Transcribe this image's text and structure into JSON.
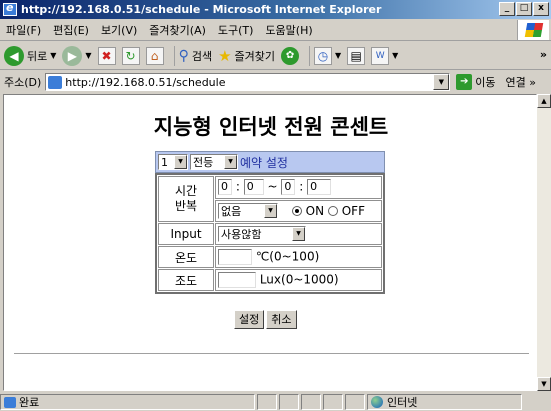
{
  "window": {
    "title": "http://192.168.0.51/schedule - Microsoft Internet Explorer",
    "btn_min": "_",
    "btn_max": "□",
    "btn_close": "x"
  },
  "menu": [
    "파일(F)",
    "편집(E)",
    "보기(V)",
    "즐겨찾기(A)",
    "도구(T)",
    "도움말(H)"
  ],
  "toolbar": {
    "back_label": "뒤로",
    "search_label": "검색",
    "favorites_label": "즐겨찾기",
    "more": "»"
  },
  "address": {
    "label": "주소(D)",
    "url": "http://192.168.0.51/schedule",
    "go_label": "이동",
    "links_label": "연결 »"
  },
  "page": {
    "title": "지능형 인터넷 전원 콘센트",
    "header": {
      "slot_value": "1",
      "device_value": "전등",
      "label": "예약 설정"
    },
    "rows": {
      "time_label": "시간",
      "time_start_h": "0",
      "time_start_m": "0",
      "time_sep": "~",
      "time_end_h": "0",
      "time_end_m": "0",
      "repeat_label": "반복",
      "repeat_value": "없음",
      "on_label": "ON",
      "off_label": "OFF",
      "input_label": "Input",
      "input_value": "사용않함",
      "temp_label": "온도",
      "temp_value": "",
      "temp_unit": "℃(0~100)",
      "lux_label": "조도",
      "lux_value": "",
      "lux_unit": "Lux(0~1000)"
    },
    "buttons": {
      "set": "설정",
      "cancel": "취소"
    }
  },
  "status": {
    "left": "완료",
    "zone": "인터넷"
  }
}
